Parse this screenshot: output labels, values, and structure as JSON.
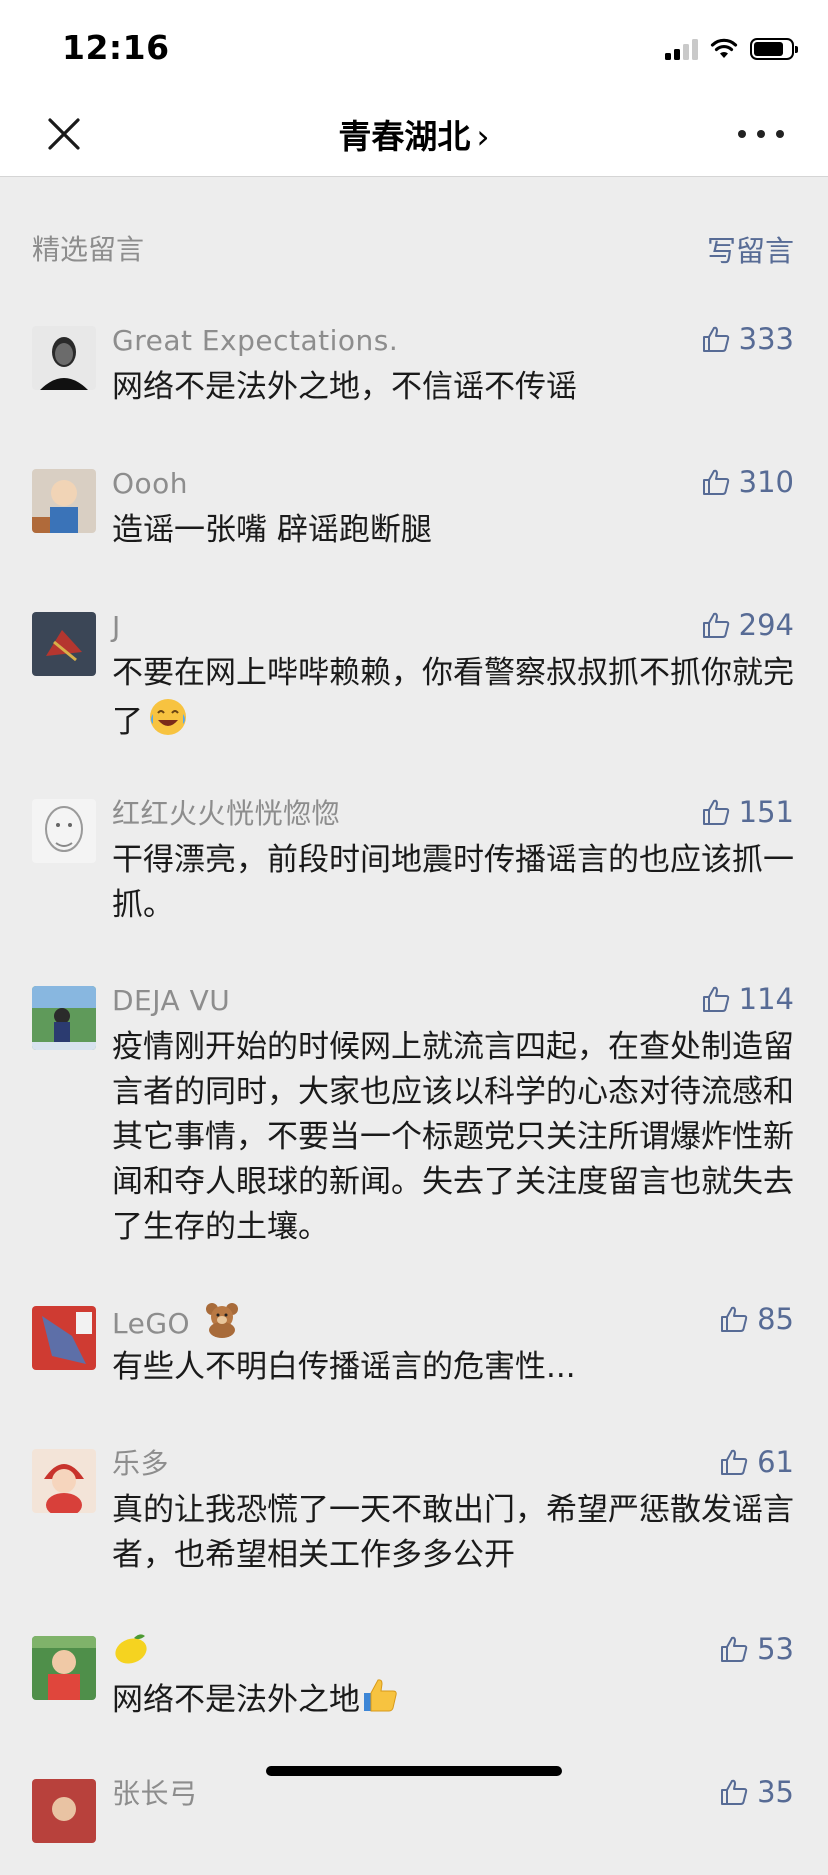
{
  "status": {
    "time": "12:16",
    "battery_level": 0.8
  },
  "nav": {
    "title": "青春湖北",
    "title_chevron": "›"
  },
  "section": {
    "title": "精选留言",
    "write_label": "写留言"
  },
  "comments": [
    {
      "name": "Great Expectations.",
      "likes": "333",
      "text": "网络不是法外之地，不信谣不传谣"
    },
    {
      "name": "Oooh",
      "likes": "310",
      "text": "造谣一张嘴 辟谣跑断腿"
    },
    {
      "name": "J",
      "likes": "294",
      "text": "不要在网上哔哔赖赖，你看警察叔叔抓不抓你就完了",
      "emoji": "face-with-tears-of-joy"
    },
    {
      "name": "红红火火恍恍惚惚",
      "likes": "151",
      "text": "干得漂亮，前段时间地震时传播谣言的也应该抓一抓。"
    },
    {
      "name": "DEJA VU",
      "likes": "114",
      "text": "疫情刚开始的时候网上就流言四起，在查处制造留言者的同时，大家也应该以科学的心态对待流感和其它事情，不要当一个标题党只关注所谓爆炸性新闻和夺人眼球的新闻。失去了关注度留言也就失去了生存的土壤。"
    },
    {
      "name": "LeGO",
      "name_emoji": "teddy-bear",
      "likes": "85",
      "text": "有些人不明白传播谣言的危害性..."
    },
    {
      "name": "乐多",
      "likes": "61",
      "text": "真的让我恐慌了一天不敢出门，希望严惩散发谣言者，也希望相关工作多多公开"
    },
    {
      "name": "",
      "name_emoji": "lemon",
      "likes": "53",
      "text": "网络不是法外之地",
      "emoji": "thumbs-up"
    },
    {
      "name": "张长弓",
      "likes": "35",
      "text": ""
    }
  ],
  "colors": {
    "link": "#576b95",
    "meta": "#8d8d8d",
    "bg": "#ededed"
  }
}
